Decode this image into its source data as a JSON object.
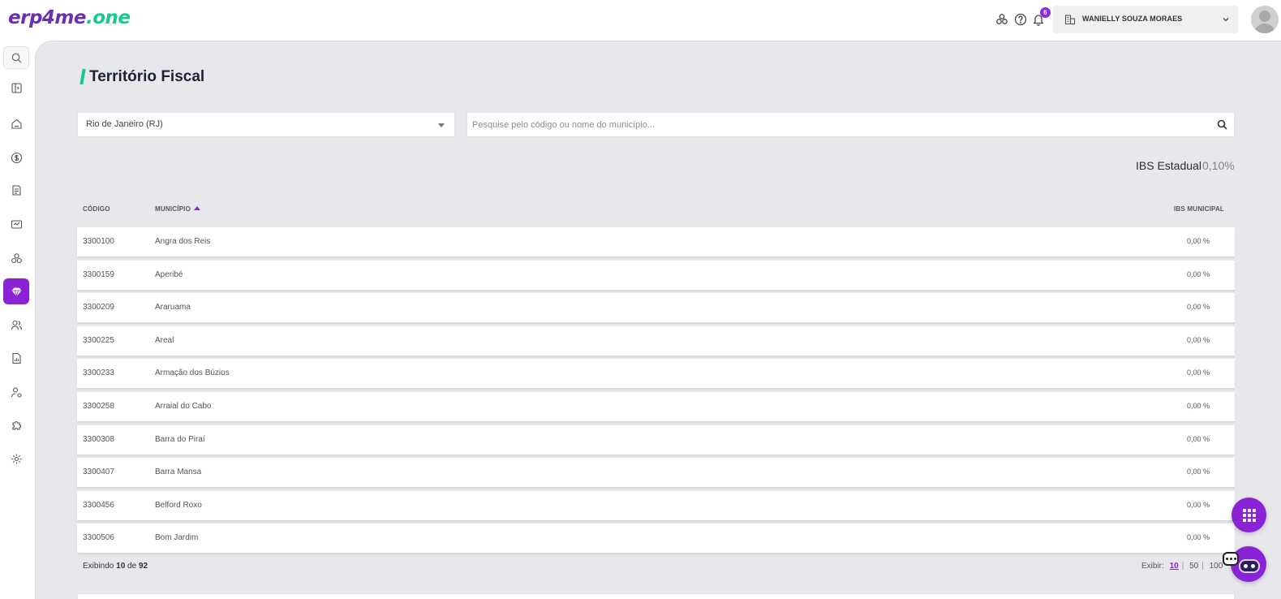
{
  "app": {
    "logo_part1": "erp4me",
    "logo_part2": ".one"
  },
  "header": {
    "notifications_count": "6",
    "company_name": "WANIELLY SOUZA MORAES",
    "icons": [
      "modules-icon",
      "help-icon",
      "bell-icon",
      "building-icon",
      "chevron-down-icon",
      "user-avatar"
    ]
  },
  "sidebar": {
    "items": [
      {
        "icon": "search-icon"
      },
      {
        "icon": "sidebar-toggle-icon"
      },
      {
        "icon": "home-icon"
      },
      {
        "icon": "dollar-icon"
      },
      {
        "icon": "invoice-icon"
      },
      {
        "icon": "handshake-icon"
      },
      {
        "icon": "modules-icon"
      },
      {
        "icon": "diamond-icon",
        "active": true
      },
      {
        "icon": "users-icon"
      },
      {
        "icon": "report-icon"
      },
      {
        "icon": "user-settings-icon"
      },
      {
        "icon": "puzzle-icon"
      },
      {
        "icon": "gear-icon"
      }
    ],
    "active_color": "#8a22d6"
  },
  "page": {
    "title": "Território Fiscal"
  },
  "filters": {
    "state_value": "Rio de Janeiro (RJ)",
    "search_placeholder": "Pesquise pelo código ou nome do município..."
  },
  "ibs": {
    "label": "IBS Estadual",
    "value": "0,10%"
  },
  "table": {
    "columns": {
      "code": "CÓDIGO",
      "municipality": "MUNICÍPIO",
      "ibs": "IBS MUNICIPAL"
    },
    "rows": [
      {
        "code": "3300100",
        "municipality": "Angra dos Reis",
        "ibs": "0,00 %"
      },
      {
        "code": "3300159",
        "municipality": "Aperibé",
        "ibs": "0,00 %"
      },
      {
        "code": "3300209",
        "municipality": "Araruama",
        "ibs": "0,00 %"
      },
      {
        "code": "3300225",
        "municipality": "Areal",
        "ibs": "0,00 %"
      },
      {
        "code": "3300233",
        "municipality": "Armação dos Búzios",
        "ibs": "0,00 %"
      },
      {
        "code": "3300258",
        "municipality": "Arraial do Cabo",
        "ibs": "0,00 %"
      },
      {
        "code": "3300308",
        "municipality": "Barra do Piraí",
        "ibs": "0,00 %"
      },
      {
        "code": "3300407",
        "municipality": "Barra Mansa",
        "ibs": "0,00 %"
      },
      {
        "code": "3300456",
        "municipality": "Belford Roxo",
        "ibs": "0,00 %"
      },
      {
        "code": "3300506",
        "municipality": "Bom Jardim",
        "ibs": "0,00 %"
      }
    ]
  },
  "pagination": {
    "showing_prefix": "Exibindo",
    "showing_count": "10",
    "showing_of": "de",
    "total": "92",
    "per_page_label": "Exibir:",
    "options": [
      "10",
      "50",
      "100"
    ],
    "selected": "10"
  },
  "colors": {
    "accent": "#8a22d6",
    "brand_green": "#18c98f",
    "background": "#e8e8ec"
  }
}
